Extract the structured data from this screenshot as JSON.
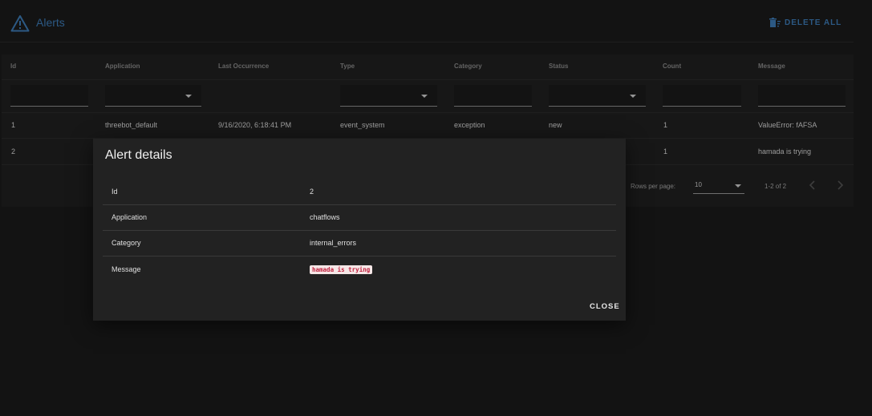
{
  "header": {
    "title": "Alerts",
    "delete_all_label": "DELETE ALL"
  },
  "table": {
    "columns": [
      "Id",
      "Application",
      "Last Occurrence",
      "Type",
      "Category",
      "Status",
      "Count",
      "Message"
    ],
    "rows": [
      {
        "id": "1",
        "application": "threebot_default",
        "last_occurrence": "9/16/2020, 6:18:41 PM",
        "type": "event_system",
        "category": "exception",
        "status": "new",
        "count": "1",
        "message": "ValueError: fAFSA"
      },
      {
        "id": "2",
        "count": "1",
        "message": "hamada is trying"
      }
    ],
    "pagination": {
      "rows_per_page_label": "Rows per page:",
      "rows_per_page_value": "10",
      "range_text": "1-2 of 2"
    }
  },
  "dialog": {
    "title": "Alert details",
    "fields": [
      {
        "key": "Id",
        "value": "2"
      },
      {
        "key": "Application",
        "value": "chatflows"
      },
      {
        "key": "Category",
        "value": "internal_errors"
      },
      {
        "key": "Message",
        "value": "hamada is trying"
      }
    ],
    "close_label": "CLOSE"
  },
  "icons": {
    "header": "warning-triangle-icon",
    "delete_all": "delete-sweep-icon",
    "pager_prev": "chevron-left-icon",
    "pager_next": "chevron-right-icon"
  },
  "colors": {
    "accent": "#3d7cb8",
    "background": "#1b1b1b",
    "code_text": "#c0223f",
    "code_bg": "#f6e7e7"
  }
}
